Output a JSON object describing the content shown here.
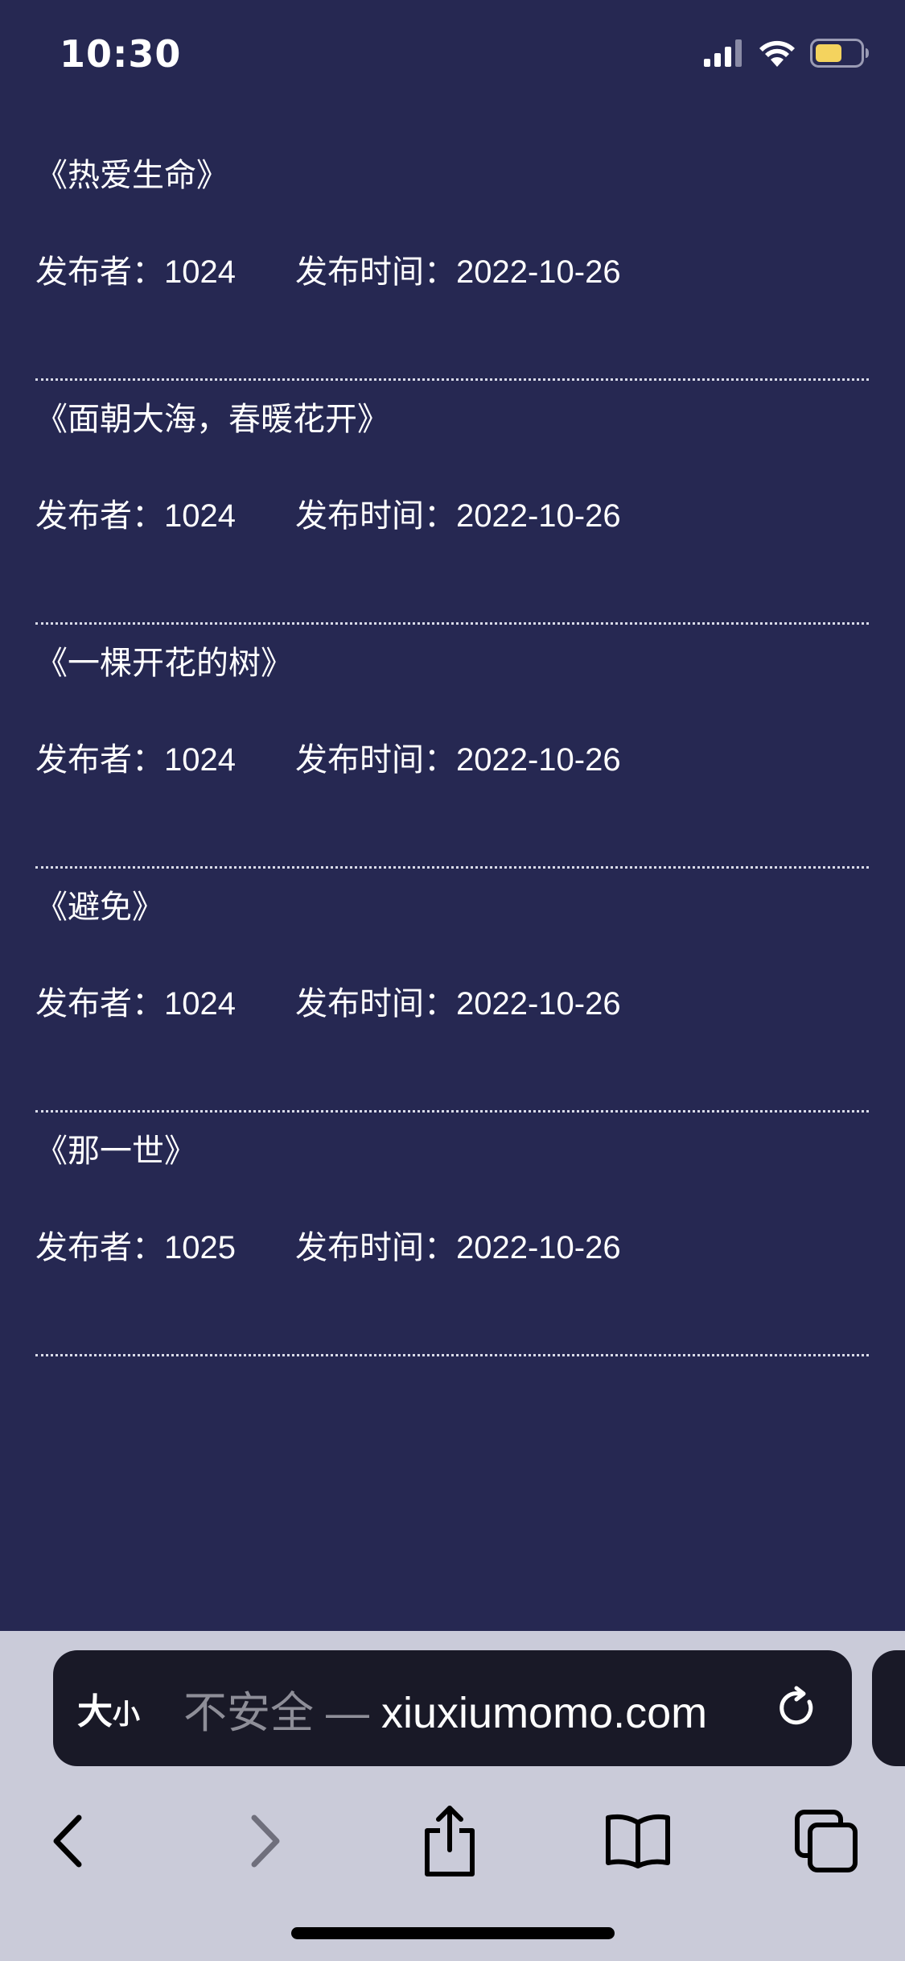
{
  "status_bar": {
    "time": "10:30"
  },
  "articles": [
    {
      "title": "《热爱生命》",
      "publisher": "发布者：1024",
      "publish_time": "发布时间：2022-10-26"
    },
    {
      "title": "《面朝大海，春暖花开》",
      "publisher": "发布者：1024",
      "publish_time": "发布时间：2022-10-26"
    },
    {
      "title": "《一棵开花的树》",
      "publisher": "发布者：1024",
      "publish_time": "发布时间：2022-10-26"
    },
    {
      "title": "《避免》",
      "publisher": "发布者：1024",
      "publish_time": "发布时间：2022-10-26"
    },
    {
      "title": "《那一世》",
      "publisher": "发布者：1025",
      "publish_time": "发布时间：2022-10-26"
    }
  ],
  "browser": {
    "text_size_label_big": "大",
    "text_size_label_small": "小",
    "url_prefix": "不安全 — ",
    "url_domain": "xiuxiumomo.com"
  },
  "colors": {
    "page_background": "#262852",
    "toolbar_background": "#cacbd9",
    "address_bar_background": "#191927",
    "battery_fill": "#f4d35e"
  },
  "icons": {
    "signal": "cellular-signal-icon",
    "wifi": "wifi-icon",
    "battery": "battery-icon",
    "reload": "reload-icon",
    "back": "chevron-left-icon",
    "forward": "chevron-right-icon",
    "share": "share-icon",
    "bookmarks": "book-icon",
    "tabs": "tabs-icon"
  }
}
